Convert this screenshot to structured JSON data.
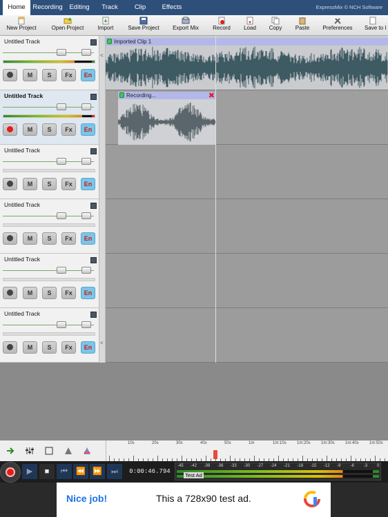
{
  "tabs": [
    {
      "label": "Home",
      "active": true
    },
    {
      "label": "Recording",
      "active": false
    },
    {
      "label": "Editing",
      "active": false
    },
    {
      "label": "Track",
      "active": false
    },
    {
      "label": "Clip",
      "active": false
    },
    {
      "label": "Effects",
      "active": false
    }
  ],
  "brand": "ExpressMix © NCH Software",
  "toolbar": [
    {
      "label": "New Project",
      "icon": "new-project-icon"
    },
    {
      "label": "Open Project",
      "icon": "open-project-icon"
    },
    {
      "label": "Import",
      "icon": "import-icon"
    },
    {
      "label": "Save Project",
      "icon": "save-project-icon"
    },
    {
      "label": "Export Mix",
      "icon": "export-mix-icon"
    },
    {
      "label": "Record",
      "icon": "record-icon"
    },
    {
      "label": "Load",
      "icon": "load-icon"
    },
    {
      "label": "Copy",
      "icon": "copy-icon"
    },
    {
      "label": "Paste",
      "icon": "paste-icon"
    },
    {
      "label": "Preferences",
      "icon": "preferences-icon"
    },
    {
      "label": "Save to I",
      "icon": "save-to-icon"
    }
  ],
  "tracks": [
    {
      "name": "Untitled Track",
      "selected": false,
      "armed": false,
      "level": 0.78
    },
    {
      "name": "Untitled Track",
      "selected": true,
      "armed": true,
      "level": 0.86
    },
    {
      "name": "Untitled Track",
      "selected": false,
      "armed": false,
      "level": 0
    },
    {
      "name": "Untitled Track",
      "selected": false,
      "armed": false,
      "level": 0
    },
    {
      "name": "Untitled Track",
      "selected": false,
      "armed": false,
      "level": 0
    },
    {
      "name": "Untitled Track",
      "selected": false,
      "armed": false,
      "level": 0
    }
  ],
  "track_buttons": {
    "mute": "M",
    "solo": "S",
    "fx": "Fx",
    "enable": "En"
  },
  "clips": {
    "imported": "Imported Clip 1",
    "recording": "Recording..."
  },
  "ruler": [
    "10s",
    "20s",
    "30s",
    "40s",
    "50s",
    "1m",
    "1m:10s",
    "1m:20s",
    "1m:30s",
    "1m:40s",
    "1m:50s"
  ],
  "timecode": "0:00:46.794",
  "vu_labels": [
    "-45",
    "-42",
    "-39",
    "-36",
    "-33",
    "-30",
    "-27",
    "-24",
    "-21",
    "-18",
    "-15",
    "-12",
    "-9",
    "-6",
    "-3",
    "0"
  ],
  "ad": {
    "tag": "Test Ad",
    "nice": "Nice job!",
    "text": "This a 728x90 test ad."
  },
  "colors": {
    "accent": "#2d4f7a",
    "record": "#e51c1c",
    "enable": "#7cc5e8"
  }
}
